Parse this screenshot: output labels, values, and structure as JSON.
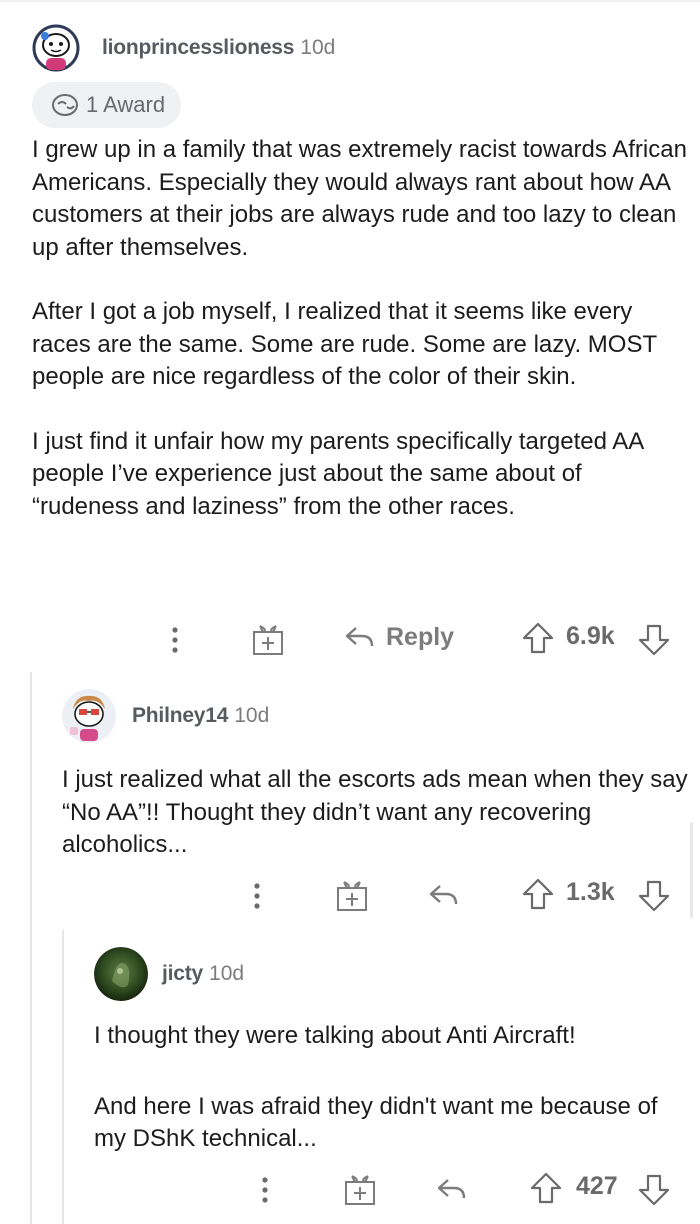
{
  "comments": [
    {
      "username": "lionprincesslioness",
      "time": "10d",
      "award": "1 Award",
      "paragraphs": [
        "I grew up in a family that was extremely racist towards African Americans. Especially they would always rant about how AA customers at their jobs are always rude and too lazy to clean up after themselves.",
        "After I got a job myself, I realized that it seems like every  races are the same. Some are rude. Some are lazy. MOST people are nice regardless of the color of their skin.",
        "I just find it unfair how my parents specifically targeted AA people I’ve experience just about the same about of “rudeness and laziness” from the other races."
      ],
      "reply_label": "Reply",
      "score": "6.9k"
    },
    {
      "username": "Philney14",
      "time": "10d",
      "paragraphs": [
        "I just realized what all the escorts ads mean when they say “No AA”!! Thought they didn’t want any recovering alcoholics..."
      ],
      "score": "1.3k"
    },
    {
      "username": "jicty",
      "time": "10d",
      "paragraphs": [
        "I thought they were talking about Anti Aircraft!",
        "And here I was afraid they didn't want me because of my DShK technical..."
      ],
      "score": "427"
    }
  ],
  "icons": {
    "more": "more-options-icon",
    "award": "gift-award-icon",
    "reply": "reply-arrow-icon",
    "upvote": "upvote-arrow-icon",
    "downvote": "downvote-arrow-icon"
  }
}
